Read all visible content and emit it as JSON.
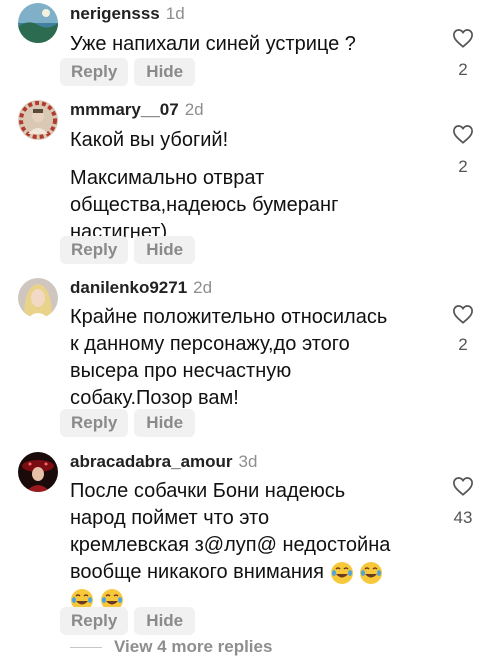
{
  "comments": [
    {
      "username": "nerigensss",
      "time": "1d",
      "lines": [
        "Уже напихали синей устрице ?"
      ],
      "reply_label": "Reply",
      "hide_label": "Hide",
      "likes": "2"
    },
    {
      "username": "mmmary__07",
      "time": "2d",
      "lines": [
        "Какой вы убогий!",
        "Максимально отврат",
        "общества,надеюсь бумеранг",
        "настигнет)"
      ],
      "reply_label": "Reply",
      "hide_label": "Hide",
      "likes": "2"
    },
    {
      "username": "danilenko9271",
      "time": "2d",
      "lines": [
        "Крайне положительно относилась",
        "к данному персонажу,до этого",
        "высера про несчастную",
        "собаку.Позор вам!"
      ],
      "reply_label": "Reply",
      "hide_label": "Hide",
      "likes": "2"
    },
    {
      "username": "abracadabra_amour",
      "time": "3d",
      "lines": [
        "После собачки Бони надеюсь",
        "народ поймет что это",
        "кремлевская з@луп@ недостойна",
        "вообще никакого внимания"
      ],
      "reply_label": "Reply",
      "hide_label": "Hide",
      "likes": "43"
    }
  ],
  "view_more_label": "View 4 more replies",
  "icons": {
    "like": "heart-outline-icon",
    "emoji": "face-with-tears-of-joy-icon"
  },
  "colors": {
    "pill_bg": "#f1f1f1",
    "muted": "#8e8e8e"
  }
}
